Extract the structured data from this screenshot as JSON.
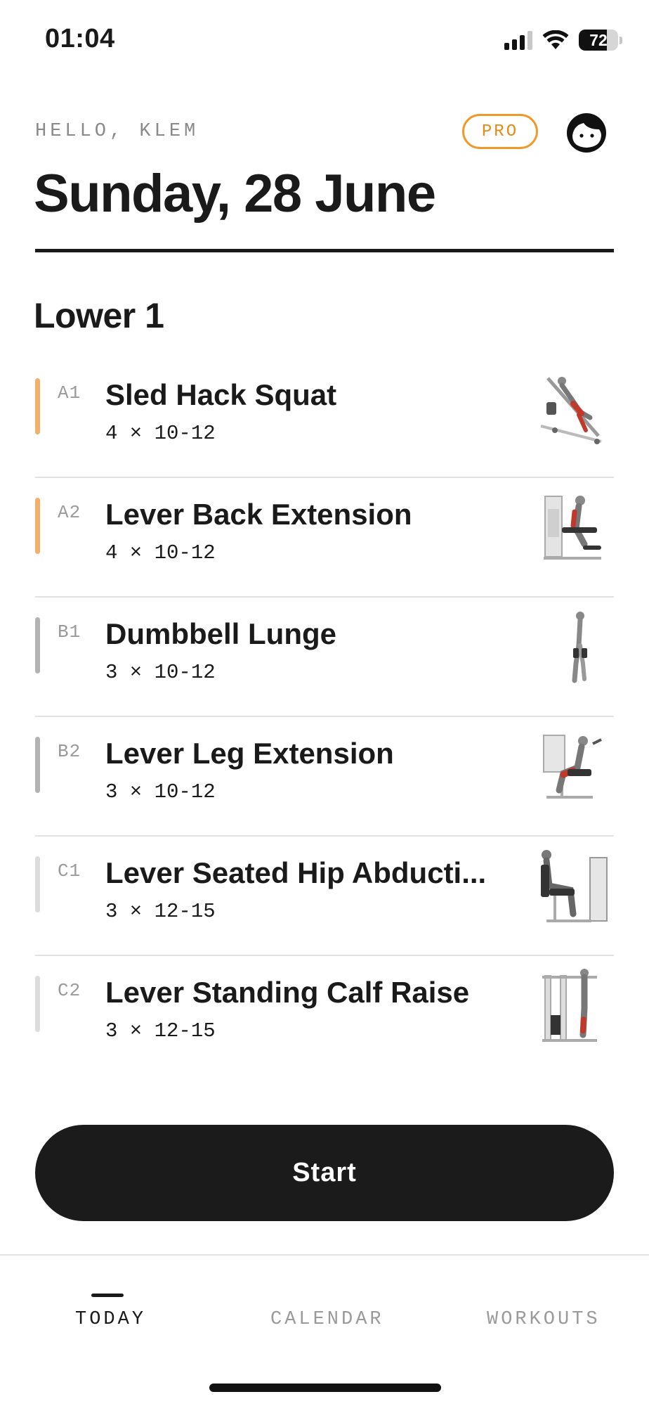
{
  "status_bar": {
    "time": "01:04",
    "battery": "72",
    "battery_level": 0.72,
    "icons": [
      "cellular-signal-icon",
      "wifi-icon",
      "battery-icon"
    ]
  },
  "header": {
    "greeting": "HELLO, KLEM",
    "pro_badge": "PRO",
    "date_title": "Sunday, 28 June",
    "avatar_icon": "face-avatar-icon"
  },
  "workout": {
    "name": "Lower 1",
    "exercises": [
      {
        "code": "A1",
        "name": "Sled Hack Squat",
        "sets": "4 × 10-12",
        "accent": "#f2b06a",
        "thumbnail": "sled-hack-squat-illustration"
      },
      {
        "code": "A2",
        "name": "Lever Back Extension",
        "sets": "4 × 10-12",
        "accent": "#f2b06a",
        "thumbnail": "lever-back-extension-illustration"
      },
      {
        "code": "B1",
        "name": "Dumbbell Lunge",
        "sets": "3 × 10-12",
        "accent": "#b3b3b3",
        "thumbnail": "dumbbell-lunge-illustration"
      },
      {
        "code": "B2",
        "name": "Lever Leg Extension",
        "sets": "3 × 10-12",
        "accent": "#b3b3b3",
        "thumbnail": "lever-leg-extension-illustration"
      },
      {
        "code": "C1",
        "name": "Lever Seated Hip Abducti...",
        "sets": "3 × 12-15",
        "accent": "#dcdcdc",
        "thumbnail": "lever-seated-hip-abduction-illustration"
      },
      {
        "code": "C2",
        "name": "Lever Standing Calf Raise",
        "sets": "3 × 12-15",
        "accent": "#dcdcdc",
        "thumbnail": "lever-standing-calf-raise-illustration"
      }
    ]
  },
  "start_button": {
    "label": "Start"
  },
  "tabs": [
    {
      "label": "TODAY",
      "active": true
    },
    {
      "label": "CALENDAR",
      "active": false
    },
    {
      "label": "WORKOUTS",
      "active": false
    }
  ],
  "colors": {
    "accent_orange": "#ee9a2b",
    "text_dark": "#1a1a1a",
    "muted_gray": "#9a9a9a",
    "button_dark": "#1b1b1b"
  }
}
